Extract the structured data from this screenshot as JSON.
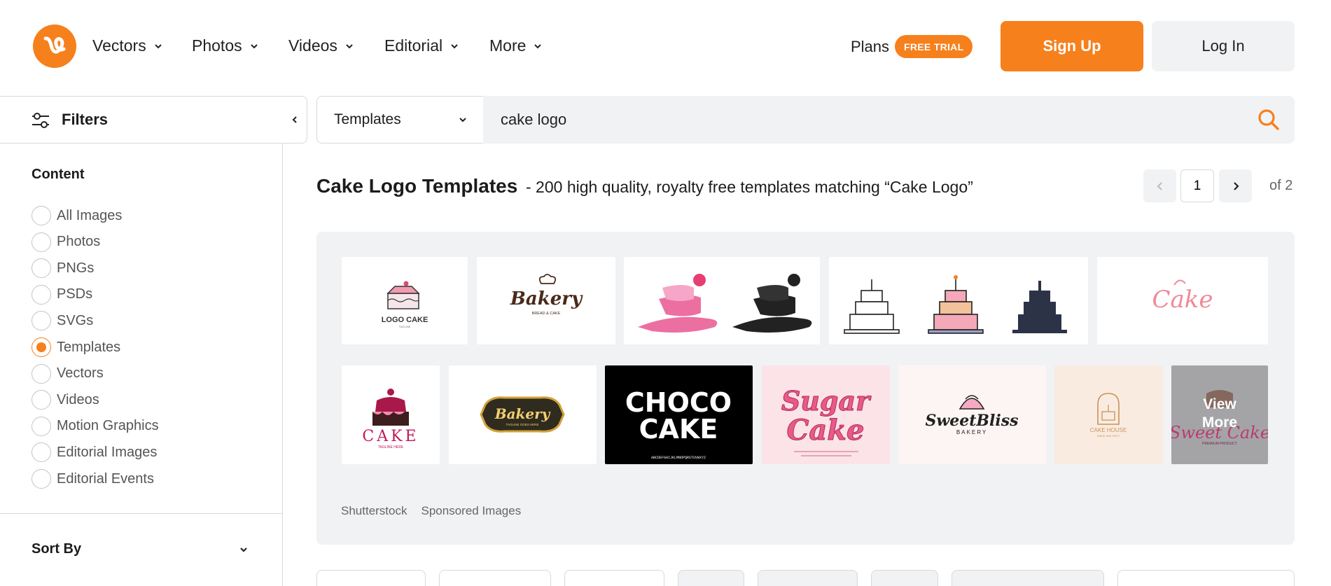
{
  "header": {
    "nav": [
      {
        "label": "Vectors"
      },
      {
        "label": "Photos"
      },
      {
        "label": "Videos"
      },
      {
        "label": "Editorial"
      },
      {
        "label": "More"
      }
    ],
    "plans_label": "Plans",
    "trial_badge": "FREE TRIAL",
    "signup_label": "Sign Up",
    "login_label": "Log In"
  },
  "sidebar": {
    "filters_label": "Filters",
    "content_title": "Content",
    "content_options": [
      {
        "label": "All Images",
        "checked": false
      },
      {
        "label": "Photos",
        "checked": false
      },
      {
        "label": "PNGs",
        "checked": false
      },
      {
        "label": "PSDs",
        "checked": false
      },
      {
        "label": "SVGs",
        "checked": false
      },
      {
        "label": "Templates",
        "checked": true
      },
      {
        "label": "Vectors",
        "checked": false
      },
      {
        "label": "Videos",
        "checked": false
      },
      {
        "label": "Motion Graphics",
        "checked": false
      },
      {
        "label": "Editorial Images",
        "checked": false
      },
      {
        "label": "Editorial Events",
        "checked": false
      }
    ],
    "sort_by_label": "Sort By"
  },
  "search": {
    "type_label": "Templates",
    "query": "cake logo"
  },
  "results": {
    "title": "Cake Logo Templates",
    "subtitle": "- 200 high quality, royalty free templates matching “Cake Logo”",
    "page": "1",
    "of_label": "of 2"
  },
  "sponsored": {
    "tiles": {
      "logo_cake": "LOGO CAKE",
      "logo_cake_tag": "TAGLINE",
      "bakery": "Bakery",
      "bakery_tag": "BREAD & CAKE",
      "cake_script": "Cake",
      "cake_serif": "CAKE",
      "cake_serif_tag": "TAGLINE HERE",
      "bakery_badge": "Bakery",
      "bakery_badge_tag": "TAGLINE GOES HERE",
      "choco_line1": "CHOCO",
      "choco_line2": "CAKE",
      "choco_alphabet": "ABCDEFGHIJKLMNOPQRSTUVWXYZ",
      "sugar_line1": "Sugar",
      "sugar_line2": "Cake",
      "sweet_bliss": "SweetBliss",
      "sweet_bliss_tag": "BAKERY",
      "cake_house": "CAKE HOUSE",
      "cake_house_tag": "SWEET AND TASTY",
      "view_more_line1": "View",
      "view_more_line2": "More",
      "sweet_cake": "Sweet Cake",
      "sweet_cake_tag": "PREMIUM PRODUCT"
    },
    "source_label": "Shutterstock",
    "sponsored_label": "Sponsored Images"
  },
  "colors": {
    "accent": "#f6801c",
    "panel": "#f1f2f4",
    "border": "#d9d9d9"
  }
}
